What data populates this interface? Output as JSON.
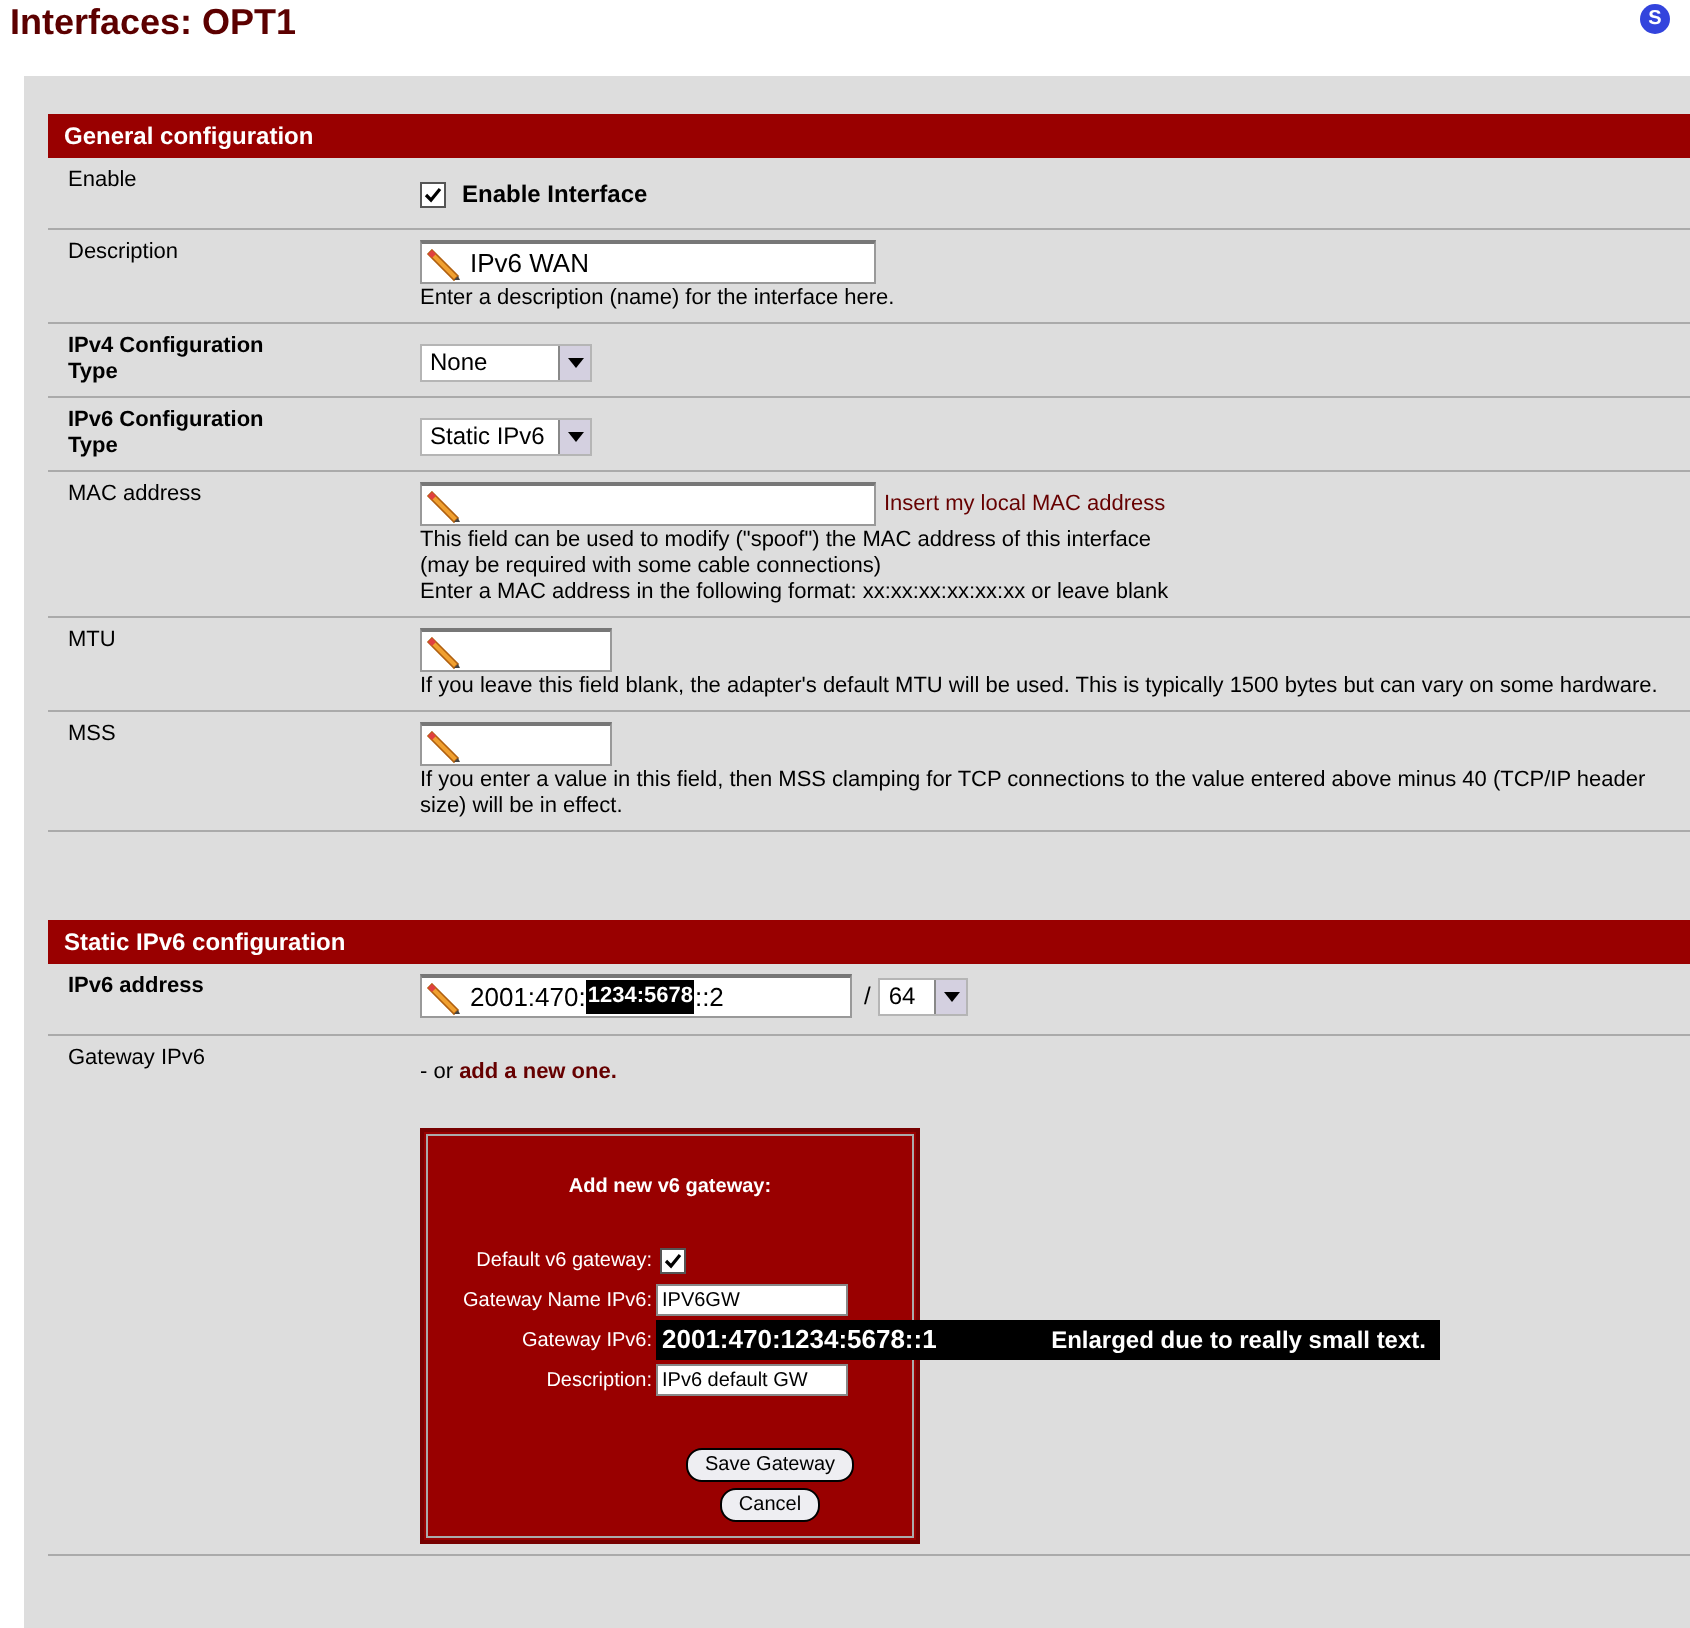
{
  "page_title": "Interfaces: OPT1",
  "help_badge": "S",
  "sections": [
    {
      "title": "General configuration",
      "rows": [
        {
          "kind": "checkbox",
          "label": "Enable",
          "label_bold": false,
          "checked": true,
          "text": "Enable Interface"
        },
        {
          "kind": "text",
          "label": "Description",
          "label_bold": false,
          "value": "IPv6 WAN",
          "notes": [
            "Enter a description (name) for the interface here."
          ]
        },
        {
          "kind": "select",
          "label": "IPv4 Configuration Type",
          "label_bold": true,
          "value": "None"
        },
        {
          "kind": "select",
          "label": "IPv6 Configuration Type",
          "label_bold": true,
          "value": "Static IPv6"
        },
        {
          "kind": "text",
          "label": "MAC address",
          "label_bold": false,
          "value": "",
          "link": "Insert my local MAC address",
          "notes": [
            "This field can be used to modify (\"spoof\") the MAC address of this interface",
            "(may be required with some cable connections)",
            "Enter a MAC address in the following format: xx:xx:xx:xx:xx:xx or leave blank"
          ]
        },
        {
          "kind": "short_text",
          "label": "MTU",
          "label_bold": false,
          "value": "",
          "notes": [
            "If you leave this field blank, the adapter's default MTU will be used. This is typically 1500 bytes but can vary on some hardware."
          ]
        },
        {
          "kind": "short_text",
          "label": "MSS",
          "label_bold": false,
          "value": "",
          "notes": [
            "If you enter a value in this field, then MSS clamping for TCP connections to the value entered above minus 40 (TCP/IP header size) will be in effect."
          ]
        }
      ]
    },
    {
      "title": "Static IPv6 configuration",
      "rows": [
        {
          "kind": "address",
          "label": "IPv6 address",
          "label_bold": true,
          "value_start": "2001:470:",
          "value_highlight": "1234:5678",
          "value_end": "::2",
          "separator": "/",
          "prefix": "64"
        },
        {
          "kind": "gateway",
          "label": "Gateway IPv6",
          "label_bold": false,
          "text": "- or ",
          "link": "add a new one.",
          "dialog": {
            "title": "Add new v6 gateway:",
            "default_label": "Default v6 gateway:",
            "default_checked": true,
            "name_label": "Gateway Name IPv6:",
            "name_value": "IPV6GW",
            "gateway_label": "Gateway IPv6:",
            "gateway_value": "2001:470:1234:5678::1",
            "gateway_note": "Enlarged due to really small text.",
            "description_label": "Description:",
            "description_value": "IPv6 default GW",
            "save": "Save Gateway",
            "cancel": "Cancel"
          }
        }
      ]
    }
  ]
}
